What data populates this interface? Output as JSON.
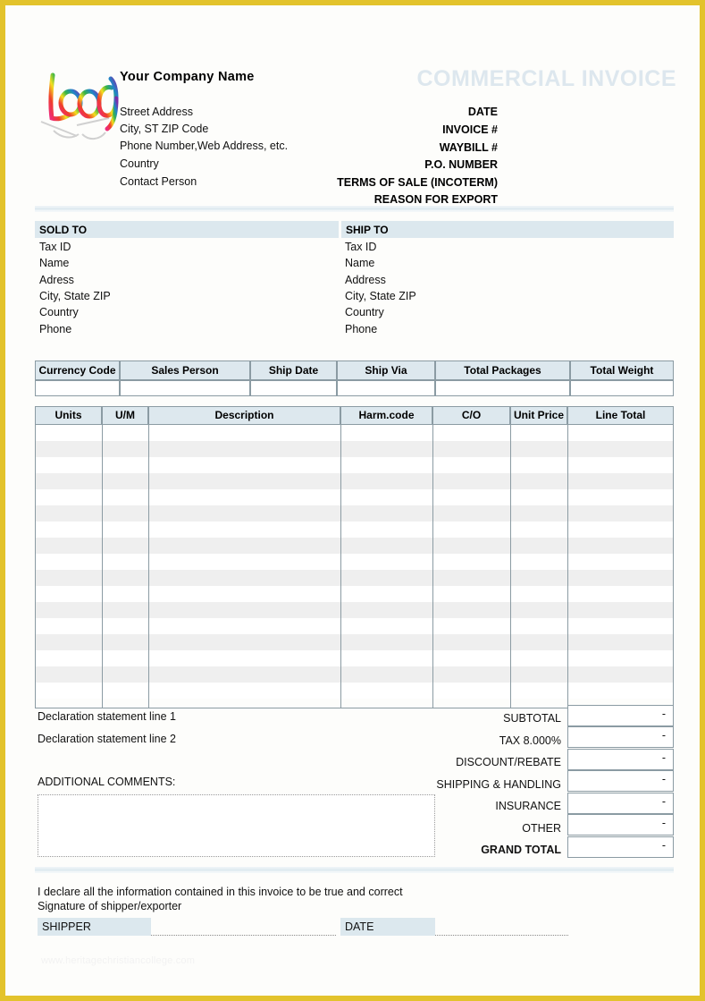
{
  "page": {
    "border_color": "#e3c32c",
    "background": "#fdfdfb",
    "watermark": "www.heritagechristiancollege.com"
  },
  "header": {
    "logo_alt": "Logo",
    "company_name": "Your Company Name",
    "company_lines": [
      "Street Address",
      "City, ST  ZIP Code",
      "Phone Number,Web Address, etc.",
      "Country",
      "Contact Person"
    ],
    "doc_title": "COMMERCIAL INVOICE",
    "doc_title_color": "#dde7ee",
    "fields": [
      "DATE",
      "INVOICE #",
      "WAYBILL #",
      "P.O. NUMBER",
      "TERMS OF SALE (INCOTERM)",
      "REASON FOR EXPORT"
    ]
  },
  "parties": {
    "band_color": "#dce8ee",
    "sold_to": {
      "title": "SOLD  TO",
      "lines": [
        "Tax ID",
        "Name",
        "Adress",
        "City, State ZIP",
        "Country",
        "Phone"
      ]
    },
    "ship_to": {
      "title": "SHIP TO",
      "lines": [
        "Tax ID",
        "Name",
        "Address",
        "City, State ZIP",
        "Country",
        "Phone"
      ]
    }
  },
  "shipping_table": {
    "headers": [
      "Currency Code",
      "Sales Person",
      "Ship Date",
      "Ship Via",
      "Total Packages",
      "Total Weight"
    ],
    "values": [
      "",
      "",
      "",
      "",
      "",
      ""
    ]
  },
  "items_table": {
    "headers": [
      "Units",
      "U/M",
      "Description",
      "Harm.code",
      "C/O",
      "Unit Price",
      "Line Total"
    ],
    "rows": [],
    "empty_row_count": 17,
    "stripe_color": "#efefef"
  },
  "declaration": {
    "line1": "Declaration statement line 1",
    "line2": "Declaration statement line 2",
    "comments_label": "ADDITIONAL COMMENTS:",
    "comments_value": ""
  },
  "totals": [
    {
      "label": "SUBTOTAL",
      "value": "-",
      "bold": false
    },
    {
      "label": "TAX    8.000%",
      "value": "-",
      "bold": false
    },
    {
      "label": "DISCOUNT/REBATE",
      "value": "-",
      "bold": false
    },
    {
      "label": "SHIPPING & HANDLING",
      "value": "-",
      "bold": false
    },
    {
      "label": "INSURANCE",
      "value": "-",
      "bold": false
    },
    {
      "label": "OTHER",
      "value": "-",
      "bold": false
    },
    {
      "label": "GRAND TOTAL",
      "value": "-",
      "bold": true
    }
  ],
  "footer": {
    "declare_line": "I declare all the information contained in this invoice to be true and correct",
    "signature_line": "Signature of shipper/exporter",
    "shipper_label": "SHIPPER",
    "shipper_value": "",
    "date_label": "DATE",
    "date_value": ""
  }
}
